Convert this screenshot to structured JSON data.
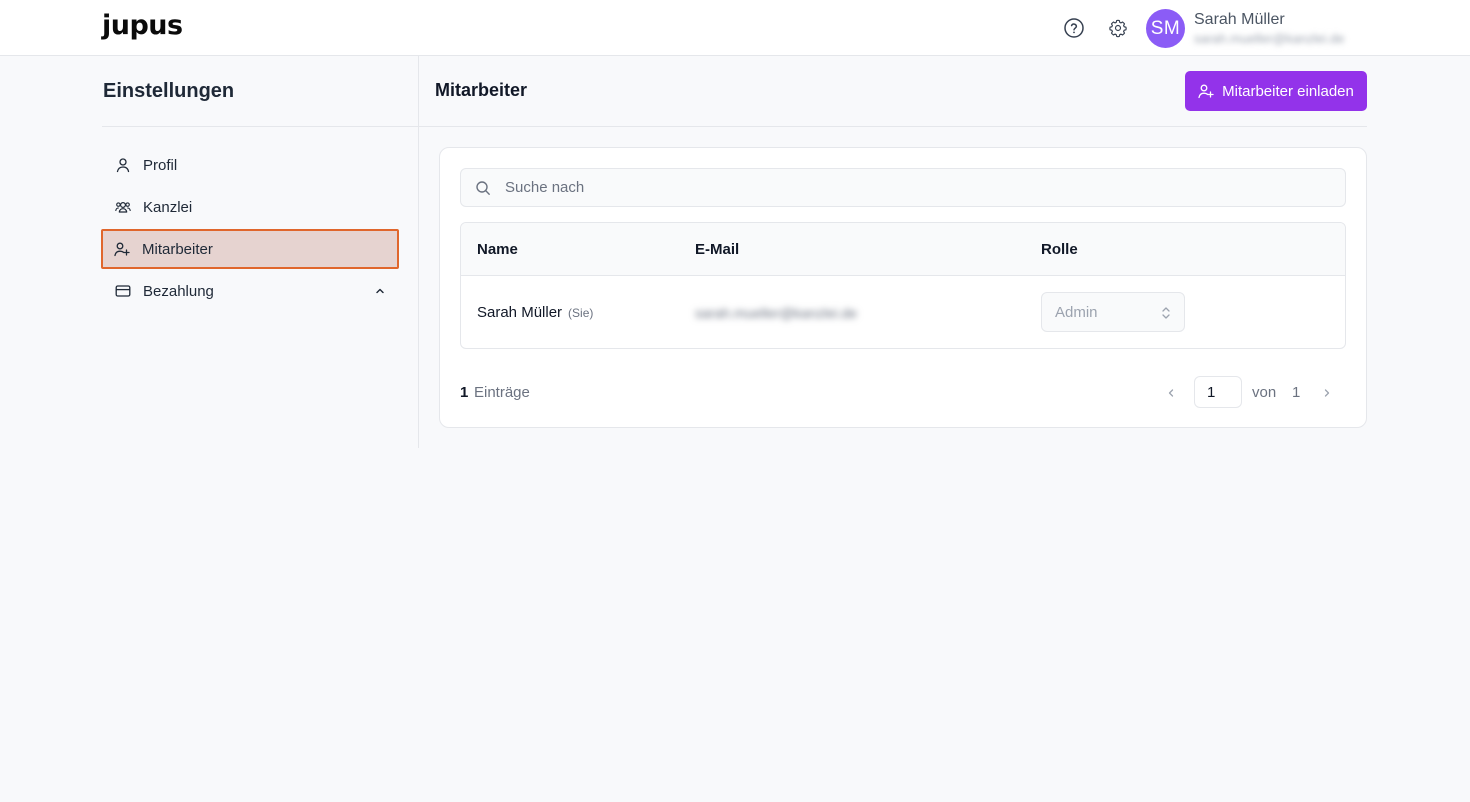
{
  "app": {
    "logo": "jupus"
  },
  "header": {
    "help_icon": "help-circle-icon",
    "settings_icon": "gear-icon",
    "user": {
      "initials": "SM",
      "name": "Sarah Müller",
      "email": "sarah.mueller@kanzlei.de"
    }
  },
  "sidebar": {
    "title": "Einstellungen",
    "items": [
      {
        "label": "Profil",
        "icon": "user-icon"
      },
      {
        "label": "Kanzlei",
        "icon": "users-group-icon"
      },
      {
        "label": "Mitarbeiter",
        "icon": "user-plus-icon",
        "active": true
      },
      {
        "label": "Bezahlung",
        "icon": "credit-card-icon",
        "chevron": "chevron-up-icon"
      }
    ]
  },
  "main": {
    "title": "Mitarbeiter",
    "invite_label": "Mitarbeiter einladen",
    "search": {
      "placeholder": "Suche nach",
      "value": ""
    },
    "table": {
      "columns": [
        "Name",
        "E-Mail",
        "Rolle"
      ],
      "rows": [
        {
          "name": "Sarah Müller",
          "you_tag": "(Sie)",
          "email": "sarah.mueller@kanzlei.de",
          "role": "Admin"
        }
      ]
    },
    "pagination": {
      "count": "1",
      "count_label": "Einträge",
      "current_page": "1",
      "of_label": "von",
      "total_pages": "1"
    }
  },
  "colors": {
    "accent": "#9333ea",
    "avatar": "#8b5cf6",
    "active_item_bg": "#e6d3d0",
    "active_item_border": "#e0662c"
  }
}
